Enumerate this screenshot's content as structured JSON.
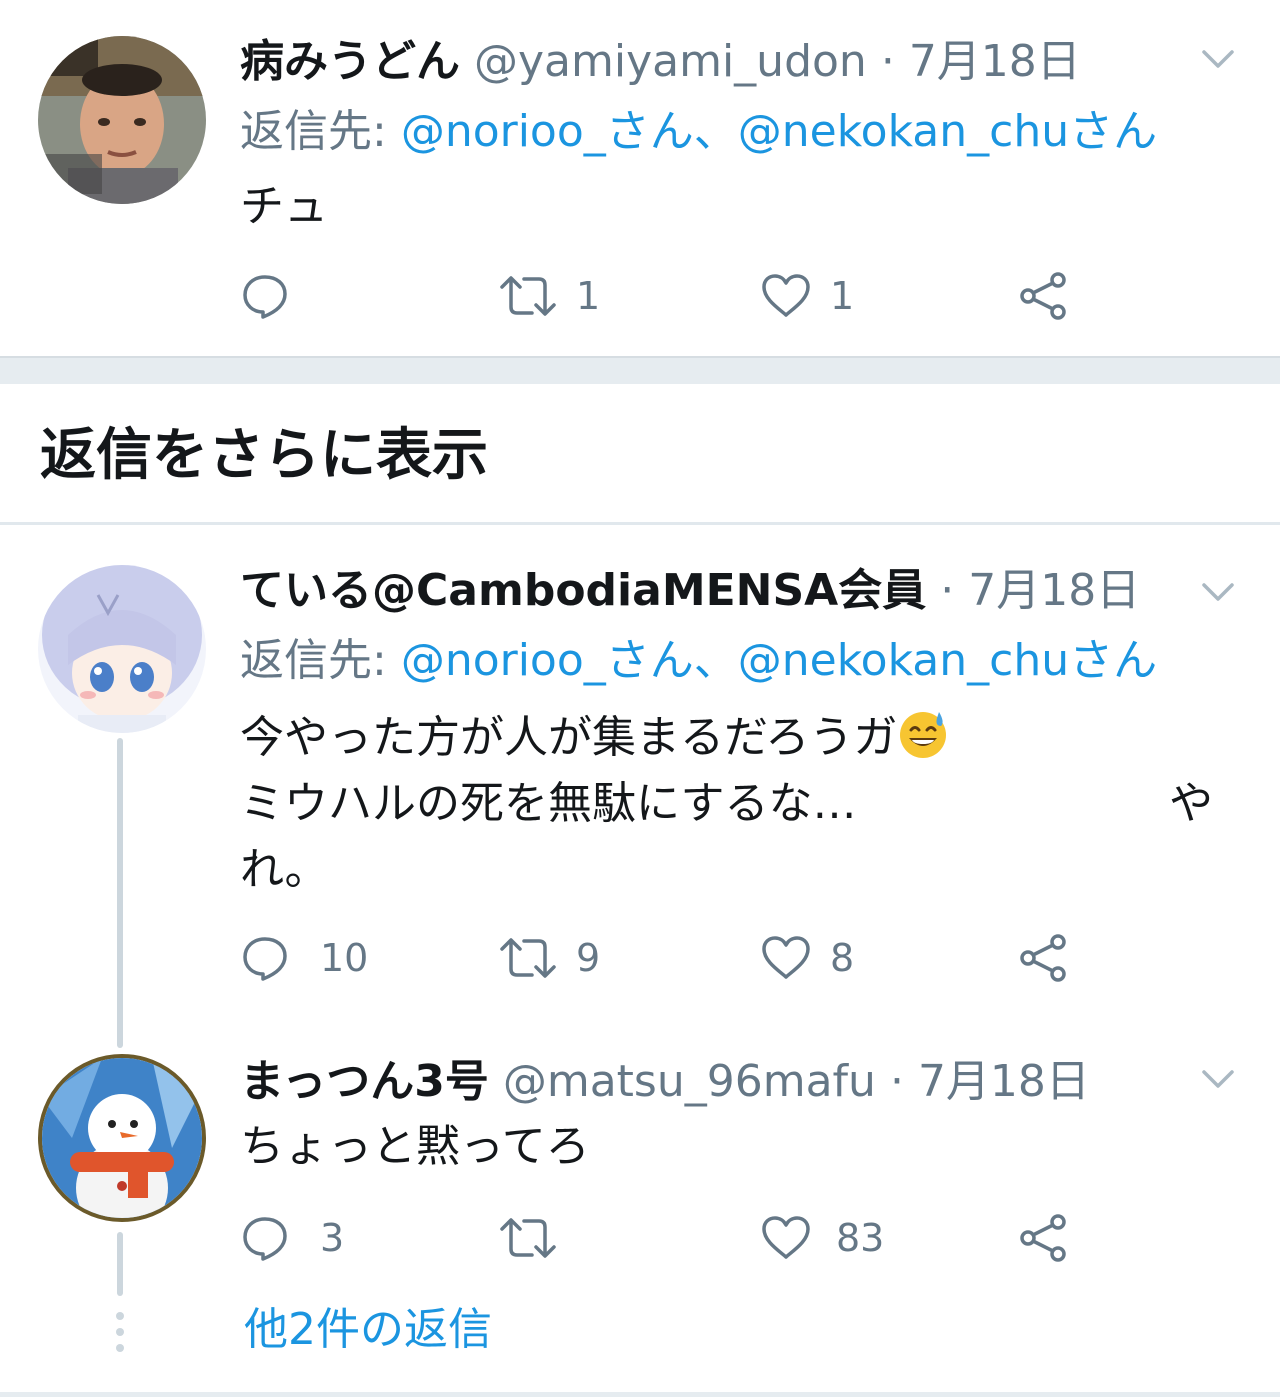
{
  "tweets": [
    {
      "name": "病みうどん",
      "handle": "@yamiyami_udon",
      "separator": "·",
      "date": "7月18日",
      "reply_prefix": "返信先: ",
      "mention1": "@norioo_さん",
      "mention_sep": "、",
      "mention2": "@nekokan_chuさん",
      "text": "チュ",
      "reply_count": "",
      "retweet_count": "1",
      "like_count": "1"
    },
    {
      "name": "ている@CambodiaMENSA会員",
      "separator": "·",
      "date": "7月18日",
      "reply_prefix": "返信先: ",
      "mention1": "@norioo_さん",
      "mention_sep": "、",
      "mention2": "@nekokan_chuさん",
      "text_line1": "今やった方が人が集まるだろうガ",
      "text_line2": "ミウハルの死を無駄にするな…",
      "text_line2_end": "や",
      "text_line3": "れ。",
      "emoji": "sweat-smile-emoji",
      "reply_count": "10",
      "retweet_count": "9",
      "like_count": "8"
    },
    {
      "name": "まっつん3号",
      "handle": "@matsu_96mafu",
      "separator": "·",
      "date": "7月18日",
      "text": "ちょっと黙ってろ",
      "reply_count": "3",
      "retweet_count": "",
      "like_count": "83"
    }
  ],
  "show_more_replies": "返信をさらに表示",
  "other_replies": "他2件の返信",
  "colors": {
    "accent": "#1b95e0",
    "secondary_text": "#657786",
    "divider": "#e6ecf0",
    "thread_line": "#ccd6dd"
  },
  "icons": [
    "chevron-down-icon",
    "reply-icon",
    "retweet-icon",
    "like-icon",
    "share-icon"
  ]
}
